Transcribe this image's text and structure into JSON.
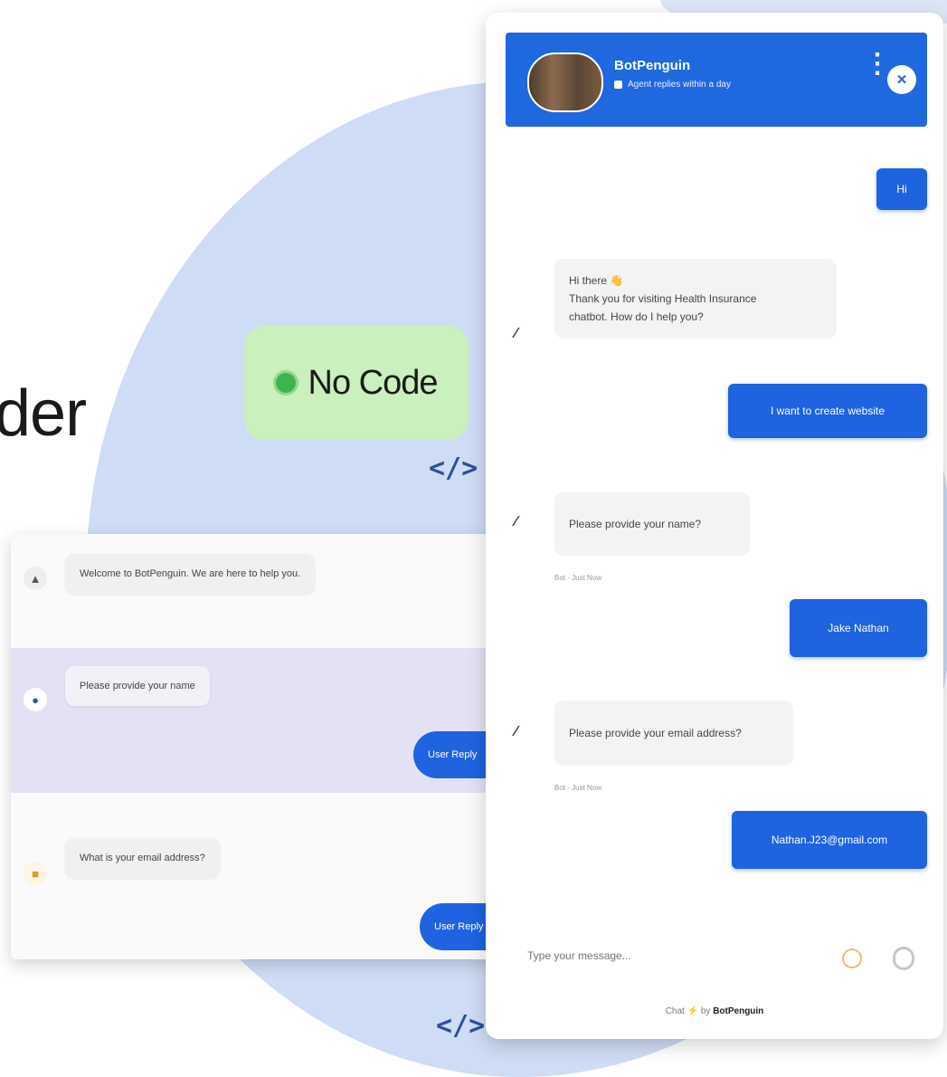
{
  "hero": {
    "text": "der"
  },
  "badge": {
    "label": "No Code"
  },
  "code_icon": "</>",
  "left_panel": {
    "rows": [
      {
        "icon": "robot-icon",
        "message": "Welcome to BotPenguin. We are here to help you."
      },
      {
        "icon": "user-icon",
        "message": "Please provide your name",
        "reply": "User Reply"
      },
      {
        "icon": "lock-icon",
        "message": "What is your email address?",
        "reply": "User Reply"
      }
    ]
  },
  "widget": {
    "title": "BotPenguin",
    "status": "Agent replies within a day",
    "close_glyph": "✕",
    "menu_glyph": "⋮",
    "messages": {
      "user_1": "Hi",
      "bot_1_line1": "Hi there 👋",
      "bot_1_line2": "Thank you for visiting Health Insurance",
      "bot_1_line3": "chatbot. How do I help you?",
      "user_2": "I want to create website",
      "bot_2": "Please provide your name?",
      "bot_2_time": "Bot · Just Now",
      "user_3": "Jake Nathan",
      "bot_3": "Please provide your email address?",
      "bot_3_time": "Bot · Just Now",
      "user_4": "Nathan.J23@gmail.com"
    },
    "input_placeholder": "Type your message...",
    "footer_prefix": "Chat ⚡ by",
    "footer_brand": "BotPenguin"
  },
  "colors": {
    "primary": "#1f63e0",
    "badge_bg": "#c9f0bd",
    "badge_dot": "#3fb34f",
    "background_circle": "#cfdcf5"
  }
}
